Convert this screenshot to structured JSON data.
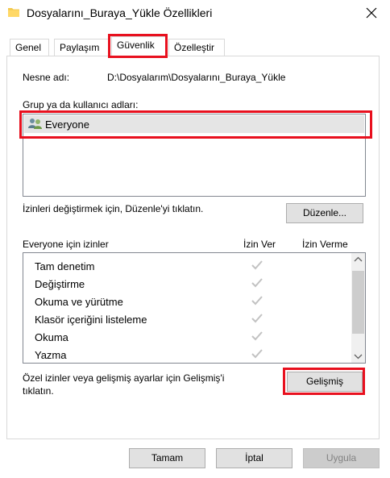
{
  "window": {
    "title": "Dosyalarını_Buraya_Yükle Özellikleri"
  },
  "tabs": [
    {
      "label": "Genel"
    },
    {
      "label": "Paylaşım"
    },
    {
      "label": "Güvenlik"
    },
    {
      "label": "Özelleştir"
    }
  ],
  "object": {
    "label": "Nesne adı:",
    "value": "D:\\Dosyalarım\\Dosyalarını_Buraya_Yükle"
  },
  "groups": {
    "label": "Grup ya da kullanıcı adları:",
    "items": [
      {
        "label": "Everyone",
        "icon": "users-icon"
      }
    ]
  },
  "edit": {
    "hint": "İzinleri değiştirmek için, Düzenle'yi tıklatın.",
    "button": "Düzenle..."
  },
  "permissions": {
    "title": "Everyone için izinler",
    "allow_header": "İzin Ver",
    "deny_header": "İzin Verme",
    "rows": [
      {
        "name": "Tam denetim",
        "allow": true,
        "deny": false
      },
      {
        "name": "Değiştirme",
        "allow": true,
        "deny": false
      },
      {
        "name": "Okuma ve yürütme",
        "allow": true,
        "deny": false
      },
      {
        "name": "Klasör içeriğini listeleme",
        "allow": true,
        "deny": false
      },
      {
        "name": "Okuma",
        "allow": true,
        "deny": false
      },
      {
        "name": "Yazma",
        "allow": true,
        "deny": false
      }
    ]
  },
  "advanced": {
    "hint_line1": "Özel izinler veya gelişmiş ayarlar için Gelişmiş'i",
    "hint_line2": "tıklatın.",
    "button": "Gelişmiş"
  },
  "footer": {
    "ok": "Tamam",
    "cancel": "İptal",
    "apply": "Uygula"
  },
  "colors": {
    "highlight": "#e8101e",
    "check_disabled": "#c2c2c2",
    "selected_row": "#e5e5e5"
  }
}
